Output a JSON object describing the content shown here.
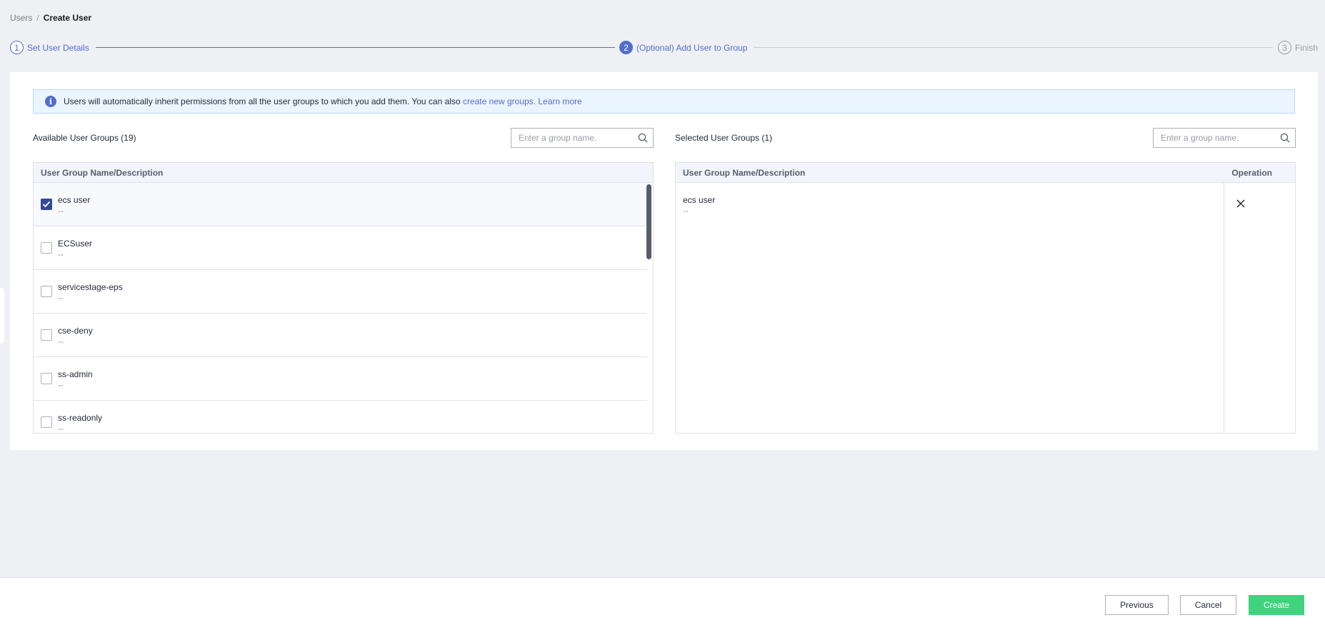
{
  "breadcrumb": {
    "parent": "Users",
    "separator": "/",
    "current": "Create User"
  },
  "steps": [
    {
      "num": "1",
      "label": "Set User Details",
      "state": "done"
    },
    {
      "num": "2",
      "label": "(Optional) Add User to Group",
      "state": "active"
    },
    {
      "num": "3",
      "label": "Finish",
      "state": "todo"
    }
  ],
  "alert": {
    "text": "Users will automatically inherit permissions from all the user groups to which you add them. You can also ",
    "link1": "create new groups.",
    "link2": "Learn more"
  },
  "available": {
    "title": "Available User Groups (19)",
    "search_placeholder": "Enter a group name.",
    "header": "User Group Name/Description",
    "rows": [
      {
        "name": "ecs user",
        "desc": "--",
        "checked": true
      },
      {
        "name": "ECSuser",
        "desc": "--",
        "checked": false
      },
      {
        "name": "servicestage-eps",
        "desc": "--",
        "checked": false
      },
      {
        "name": "cse-deny",
        "desc": "--",
        "checked": false
      },
      {
        "name": "ss-admin",
        "desc": "--",
        "checked": false
      },
      {
        "name": "ss-readonly",
        "desc": "--",
        "checked": false
      }
    ]
  },
  "selected": {
    "title": "Selected User Groups (1)",
    "search_placeholder": "Enter a group name.",
    "header": "User Group Name/Description",
    "operation_header": "Operation",
    "rows": [
      {
        "name": "ecs user",
        "desc": "--"
      }
    ]
  },
  "footer": {
    "previous": "Previous",
    "cancel": "Cancel",
    "create": "Create"
  },
  "colors": {
    "primary": "#526ecc",
    "create": "#3fd37e",
    "checkbox": "#344899"
  }
}
